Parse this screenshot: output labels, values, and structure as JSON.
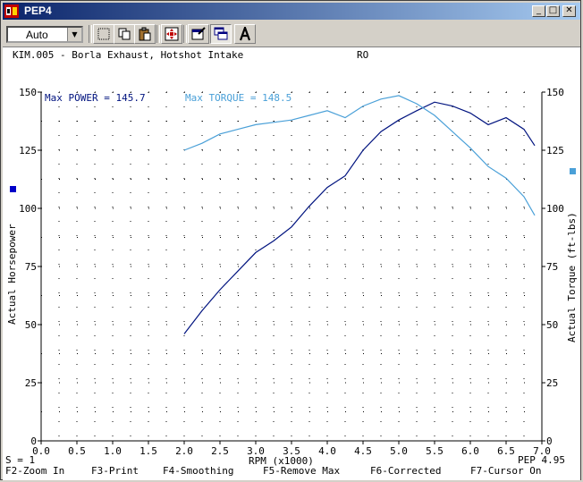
{
  "window": {
    "title": "PEP4",
    "controls": [
      "_",
      "□",
      "✕"
    ]
  },
  "toolbar": {
    "zoom_select_value": "Auto"
  },
  "run": {
    "name": "KIM.005 - Borla Exhaust, Hotshot Intake",
    "code": "RO"
  },
  "stats": {
    "max_power_label": "Max POWER = 145.7",
    "max_torque_label": "Max TORQUE = 148.5"
  },
  "status": {
    "smoothing": "S = 1",
    "version": "PEP 4.95"
  },
  "function_keys": [
    "F2-Zoom In",
    "F3-Print",
    "F4-Smoothing",
    "F5-Remove Max",
    "F6-Corrected",
    "F7-Cursor On"
  ],
  "colors": {
    "power": "#00137f",
    "torque": "#4aa0d8",
    "text_blue": "#00137f"
  },
  "chart_data": {
    "type": "line",
    "xlabel": "RPM (x1000)",
    "ylabel": "Actual Horsepower",
    "y2label": "Actual Torque (ft-lbs)",
    "xlim": [
      0,
      7.0
    ],
    "ylim": [
      0,
      150
    ],
    "y2lim": [
      0,
      150
    ],
    "x_ticks": [
      "0.0",
      "0.5",
      "1.0",
      "1.5",
      "2.0",
      "2.5",
      "3.0",
      "3.5",
      "4.0",
      "4.5",
      "5.0",
      "5.5",
      "6.0",
      "6.5",
      "7.0"
    ],
    "y_ticks": [
      "0",
      "25",
      "50",
      "75",
      "100",
      "125",
      "150"
    ],
    "y2_ticks": [
      "0",
      "25",
      "50",
      "75",
      "100",
      "125",
      "150"
    ],
    "grid": "dotted",
    "series": [
      {
        "name": "Max POWER",
        "axis": "left",
        "x": [
          2.0,
          2.25,
          2.5,
          2.75,
          3.0,
          3.25,
          3.5,
          3.75,
          4.0,
          4.25,
          4.5,
          4.75,
          5.0,
          5.25,
          5.5,
          5.75,
          6.0,
          6.25,
          6.5,
          6.75,
          6.9
        ],
        "y": [
          46,
          56,
          65,
          73,
          81,
          86,
          92,
          101,
          109,
          114,
          125,
          133,
          138,
          142,
          145.7,
          144,
          141,
          136,
          139,
          134,
          127
        ]
      },
      {
        "name": "Max TORQUE",
        "axis": "right",
        "x": [
          2.0,
          2.25,
          2.5,
          2.75,
          3.0,
          3.25,
          3.5,
          3.75,
          4.0,
          4.25,
          4.5,
          4.75,
          5.0,
          5.25,
          5.5,
          5.75,
          6.0,
          6.25,
          6.5,
          6.75,
          6.9
        ],
        "y": [
          125,
          128,
          132,
          134,
          136,
          137,
          138,
          140,
          142,
          139,
          144,
          147,
          148.5,
          145,
          140,
          133,
          126,
          118,
          113,
          105,
          97
        ]
      }
    ]
  }
}
